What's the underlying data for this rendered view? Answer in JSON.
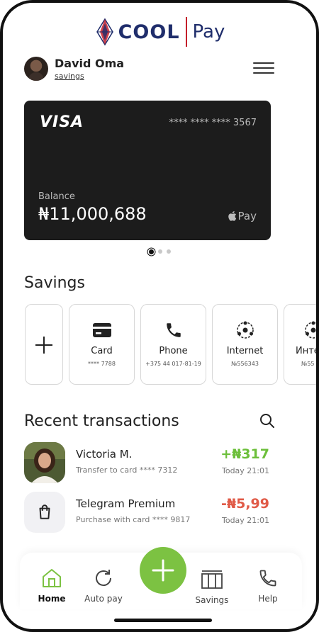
{
  "brand": {
    "name_main": "COOL",
    "name_secondary": "Pay"
  },
  "profile": {
    "name": "David Oma",
    "account_type": "savings"
  },
  "card": {
    "network": "VISA",
    "masked_number": "**** **** **** 3567",
    "balance_label": "Balance",
    "balance_value": "₦11,000,688",
    "wallet": "Pay",
    "pager_total": 3,
    "pager_active": 1
  },
  "savings": {
    "title": "Savings",
    "tiles": [
      {
        "label": "Card",
        "sub": "**** 7788",
        "icon": "card-icon"
      },
      {
        "label": "Phone",
        "sub": "+375 44 017-81-19",
        "icon": "phone-icon"
      },
      {
        "label": "Internet",
        "sub": "№556343",
        "icon": "internet-icon"
      },
      {
        "label": "Инте",
        "sub": "№55",
        "icon": "internet-icon"
      }
    ]
  },
  "transactions": {
    "title": "Recent transactions",
    "items": [
      {
        "name": "Victoria M.",
        "description": "Transfer to card **** 7312",
        "amount": "+₦317",
        "time": "Today 21:01",
        "amount_color": "#6cbf3a"
      },
      {
        "name": "Telegram Premium",
        "description": "Purchase with card **** 9817",
        "amount": "-₦5,99",
        "time": "Today 21:01",
        "amount_color": "#e05a47"
      }
    ]
  },
  "nav": {
    "items": [
      {
        "label": "Home",
        "icon": "home-icon",
        "active": true
      },
      {
        "label": "Auto pay",
        "icon": "refresh-icon",
        "active": false
      },
      {
        "label": "Savings",
        "icon": "savings-icon",
        "active": false
      },
      {
        "label": "Help",
        "icon": "phone-icon",
        "active": false
      }
    ],
    "fab_icon": "plus-icon"
  },
  "colors": {
    "accent": "#7cc242",
    "brand_blue": "#1f2d6b",
    "brand_red": "#c41f2b",
    "card_bg": "#1c1c1c"
  }
}
